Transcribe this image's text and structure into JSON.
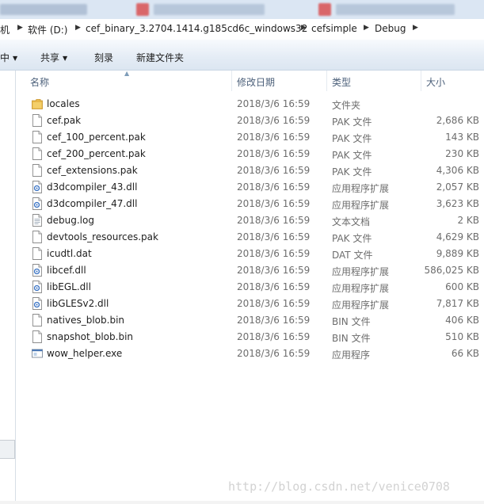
{
  "breadcrumb": [
    {
      "label": "机"
    },
    {
      "label": "软件 (D:)"
    },
    {
      "label": "cef_binary_3.2704.1414.g185cd6c_windows32"
    },
    {
      "label": "cefsimple"
    },
    {
      "label": "Debug"
    }
  ],
  "toolbar": {
    "partial_label": "中",
    "share_label": "共享",
    "burn_label": "刻录",
    "new_folder_label": "新建文件夹"
  },
  "columns": {
    "name": "名称",
    "date": "修改日期",
    "type": "类型",
    "size": "大小"
  },
  "files": [
    {
      "name": "locales",
      "date": "2018/3/6 16:59",
      "type": "文件夹",
      "size": "",
      "icon": "folder-icon"
    },
    {
      "name": "cef.pak",
      "date": "2018/3/6 16:59",
      "type": "PAK 文件",
      "size": "2,686 KB",
      "icon": "file-icon"
    },
    {
      "name": "cef_100_percent.pak",
      "date": "2018/3/6 16:59",
      "type": "PAK 文件",
      "size": "143 KB",
      "icon": "file-icon"
    },
    {
      "name": "cef_200_percent.pak",
      "date": "2018/3/6 16:59",
      "type": "PAK 文件",
      "size": "230 KB",
      "icon": "file-icon"
    },
    {
      "name": "cef_extensions.pak",
      "date": "2018/3/6 16:59",
      "type": "PAK 文件",
      "size": "4,306 KB",
      "icon": "file-icon"
    },
    {
      "name": "d3dcompiler_43.dll",
      "date": "2018/3/6 16:59",
      "type": "应用程序扩展",
      "size": "2,057 KB",
      "icon": "dll-icon"
    },
    {
      "name": "d3dcompiler_47.dll",
      "date": "2018/3/6 16:59",
      "type": "应用程序扩展",
      "size": "3,623 KB",
      "icon": "dll-icon"
    },
    {
      "name": "debug.log",
      "date": "2018/3/6 16:59",
      "type": "文本文档",
      "size": "2 KB",
      "icon": "text-file-icon"
    },
    {
      "name": "devtools_resources.pak",
      "date": "2018/3/6 16:59",
      "type": "PAK 文件",
      "size": "4,629 KB",
      "icon": "file-icon"
    },
    {
      "name": "icudtl.dat",
      "date": "2018/3/6 16:59",
      "type": "DAT 文件",
      "size": "9,889 KB",
      "icon": "file-icon"
    },
    {
      "name": "libcef.dll",
      "date": "2018/3/6 16:59",
      "type": "应用程序扩展",
      "size": "586,025 KB",
      "icon": "dll-icon"
    },
    {
      "name": "libEGL.dll",
      "date": "2018/3/6 16:59",
      "type": "应用程序扩展",
      "size": "600 KB",
      "icon": "dll-icon"
    },
    {
      "name": "libGLESv2.dll",
      "date": "2018/3/6 16:59",
      "type": "应用程序扩展",
      "size": "7,817 KB",
      "icon": "dll-icon"
    },
    {
      "name": "natives_blob.bin",
      "date": "2018/3/6 16:59",
      "type": "BIN 文件",
      "size": "406 KB",
      "icon": "file-icon"
    },
    {
      "name": "snapshot_blob.bin",
      "date": "2018/3/6 16:59",
      "type": "BIN 文件",
      "size": "510 KB",
      "icon": "file-icon"
    },
    {
      "name": "wow_helper.exe",
      "date": "2018/3/6 16:59",
      "type": "应用程序",
      "size": "66 KB",
      "icon": "exe-icon"
    }
  ],
  "watermark": "http://blog.csdn.net/venice0708"
}
